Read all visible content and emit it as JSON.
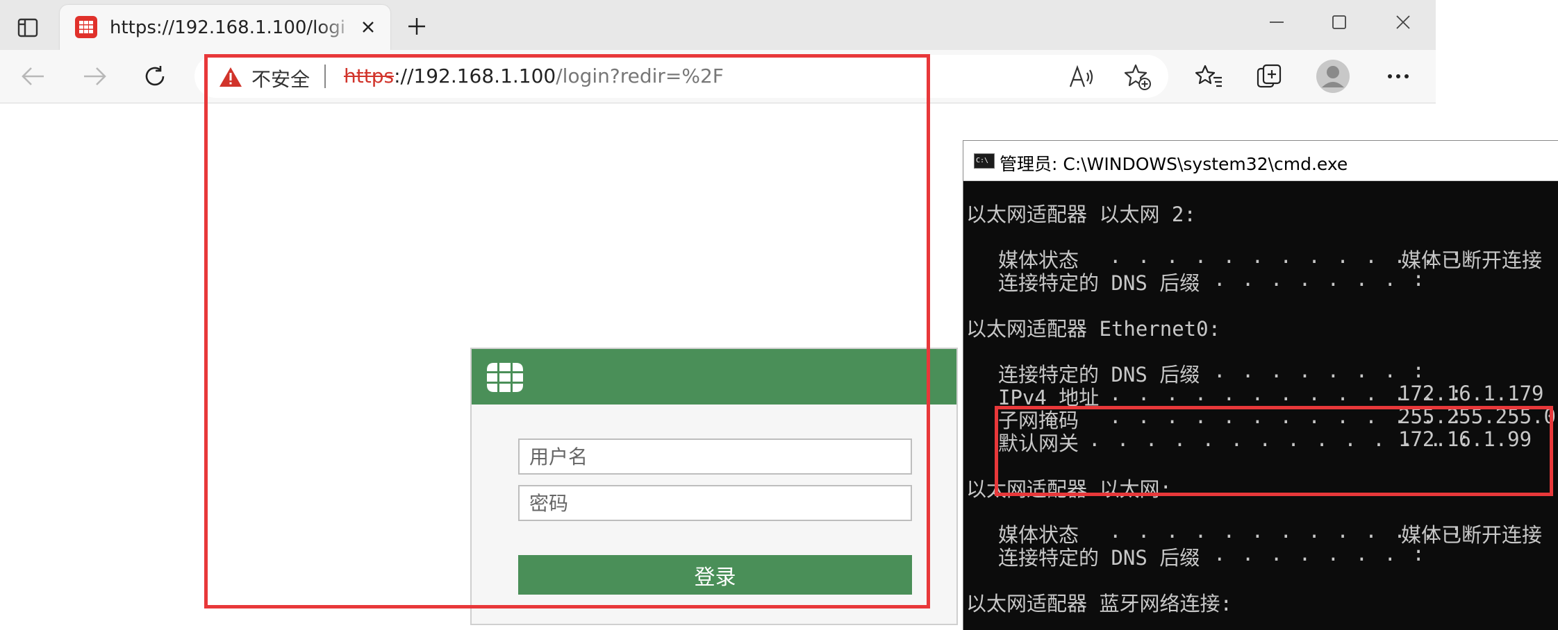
{
  "browser": {
    "tab": {
      "title": "https://192.168.1.100/login?redir"
    },
    "address_bar": {
      "security_label": "不安全",
      "url_scheme": "https",
      "url_host": "://192.168.1.100",
      "url_path": "/login?redir=%2F"
    },
    "icons": {
      "sidebar": "tab-actions-icon",
      "favicon": "fortinet-favicon",
      "close": "close-icon",
      "new_tab": "plus-icon",
      "back": "arrow-left-icon",
      "forward": "arrow-right-icon",
      "reload": "reload-icon",
      "warning": "warning-triangle-icon",
      "read_aloud": "read-aloud-icon",
      "add_favorite": "star-plus-icon",
      "favorites": "favorites-icon",
      "collections": "collections-icon",
      "profile": "profile-avatar-icon",
      "more": "more-dots-icon"
    }
  },
  "login": {
    "username_placeholder": "用户名",
    "password_placeholder": "密码",
    "submit_label": "登录",
    "header_color": "#4a8f58"
  },
  "cmd": {
    "title": "管理员: C:\\WINDOWS\\system32\\cmd.exe",
    "icon_text": "C:\\",
    "sections": [
      {
        "header": "以太网适配器 以太网 2:",
        "rows": [
          {
            "label": "媒体状态",
            "dots": ". . . . . . . . . . . . :",
            "value": "媒体已断开连接"
          },
          {
            "label": "连接特定的 DNS 后缀",
            "dots": ". . . . . . . :",
            "value": ""
          }
        ]
      },
      {
        "header": "以太网适配器 Ethernet0:",
        "rows": [
          {
            "label": "连接特定的 DNS 后缀",
            "dots": ". . . . . . . :",
            "value": ""
          },
          {
            "label": "IPv4 地址",
            "dots": ". . . . . . . . . . . . :",
            "value": "172.16.1.179"
          },
          {
            "label": "子网掩码",
            "dots": ". . . . . . . . . . . . :",
            "value": "255.255.255.0"
          },
          {
            "label": "默认网关",
            "dots": ". . . . . . . . . . . . . :",
            "value": "172.16.1.99"
          }
        ]
      },
      {
        "header": "以太网适配器 以太网:",
        "rows": [
          {
            "label": "媒体状态",
            "dots": ". . . . . . . . . . . . :",
            "value": "媒体已断开连接"
          },
          {
            "label": "连接特定的 DNS 后缀",
            "dots": ". . . . . . . :",
            "value": ""
          }
        ]
      },
      {
        "header": "以太网适配器 蓝牙网络连接:",
        "rows": []
      }
    ]
  },
  "annotation_color": "#e8383a"
}
